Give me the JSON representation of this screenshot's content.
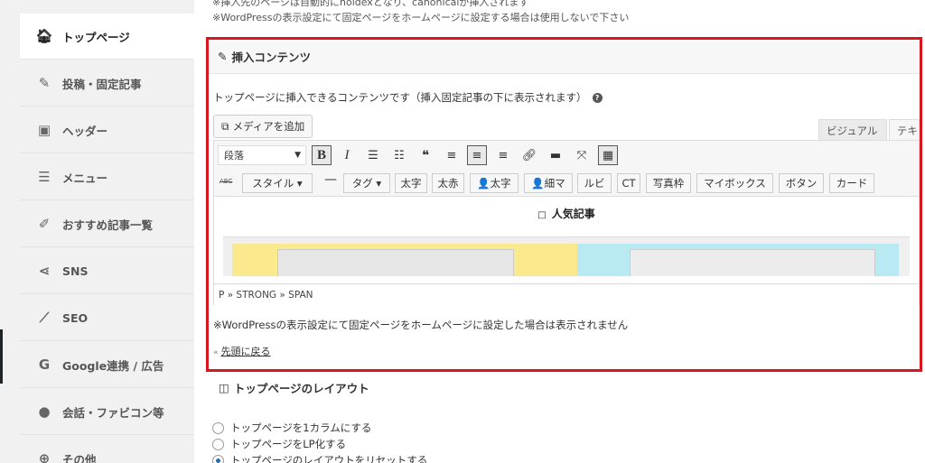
{
  "sidebar": {
    "items": [
      {
        "label": "トップページ",
        "icon": "home-icon",
        "glyph": "🏠︎",
        "active": true
      },
      {
        "label": "投稿・固定記事",
        "icon": "edit-icon",
        "glyph": "✎",
        "active": false
      },
      {
        "label": "ヘッダー",
        "icon": "image-icon",
        "glyph": "▣",
        "active": false
      },
      {
        "label": "メニュー",
        "icon": "menu-icon",
        "glyph": "☰",
        "active": false
      },
      {
        "label": "おすすめ記事一覧",
        "icon": "edit-square-icon",
        "glyph": "✐",
        "active": false
      },
      {
        "label": "SNS",
        "icon": "share-icon",
        "glyph": "⋖",
        "active": false
      },
      {
        "label": "SEO",
        "icon": "chart-line-icon",
        "glyph": "⟋",
        "active": false
      },
      {
        "label": "Google連携 / 広告",
        "icon": "google-icon",
        "glyph": "G",
        "active": false
      },
      {
        "label": "会話・ファビコン等",
        "icon": "comment-icon",
        "glyph": "●",
        "active": false
      },
      {
        "label": "その他",
        "icon": "plus-circle-icon",
        "glyph": "⊕",
        "active": false
      }
    ]
  },
  "notices": {
    "line1": "※挿入先のページは自動的にnoidexとなり、canonicalが挿入されます",
    "line2": "※WordPressの表示設定にて固定ページをホームページに設定する場合は使用しないで下さい"
  },
  "insert_box": {
    "title": "挿入コンテンツ",
    "title_glyph": "✎",
    "description": "トップページに挿入できるコンテンツです（挿入固定記事の下に表示されます）",
    "help_glyph": "?",
    "media_button": "メディアを追加",
    "media_glyph": "⧉",
    "tabs": {
      "visual": "ビジュアル",
      "text": "テキスト"
    },
    "toolbar1": {
      "format": "段落",
      "caret": "▼",
      "buttons": [
        {
          "name": "bold-button",
          "glyph": "B"
        },
        {
          "name": "italic-button",
          "glyph": "I"
        },
        {
          "name": "bullet-list-button",
          "glyph": "☰"
        },
        {
          "name": "numbered-list-button",
          "glyph": "☷"
        },
        {
          "name": "blockquote-button",
          "glyph": "❝"
        },
        {
          "name": "align-left-button",
          "glyph": "≡"
        },
        {
          "name": "align-center-button",
          "glyph": "≡"
        },
        {
          "name": "align-right-button",
          "glyph": "≡"
        },
        {
          "name": "link-button",
          "glyph": "🔗︎"
        },
        {
          "name": "read-more-button",
          "glyph": "▬"
        },
        {
          "name": "fullscreen-button",
          "glyph": "⤧"
        },
        {
          "name": "toolbar-toggle-button",
          "glyph": "▦"
        }
      ]
    },
    "toolbar2": {
      "strike_glyph": "ABC",
      "dash_glyph": "—",
      "buttons": [
        "スタイル ▾",
        "タグ ▾",
        "太字",
        "太赤",
        "👤太字",
        "👤細マ",
        "ルビ",
        "CT",
        "写真枠",
        "マイボックス",
        "ボタン",
        "カード"
      ]
    },
    "content_heading": "人気記事",
    "content_marker": "□",
    "path": "P » STRONG » SPAN",
    "note": "※WordPressの表示設定にて固定ページをホームページに設定した場合は表示されません",
    "back_to_top": "先頭に戻る",
    "back_glyph": "«"
  },
  "layout_section": {
    "title": "トップページのレイアウト",
    "title_glyph": "◫",
    "options": [
      {
        "label": "トップページを1カラムにする",
        "checked": false
      },
      {
        "label": "トップページをLP化する",
        "checked": false
      },
      {
        "label": "トップページのレイアウトをリセットする",
        "checked": true
      }
    ]
  }
}
